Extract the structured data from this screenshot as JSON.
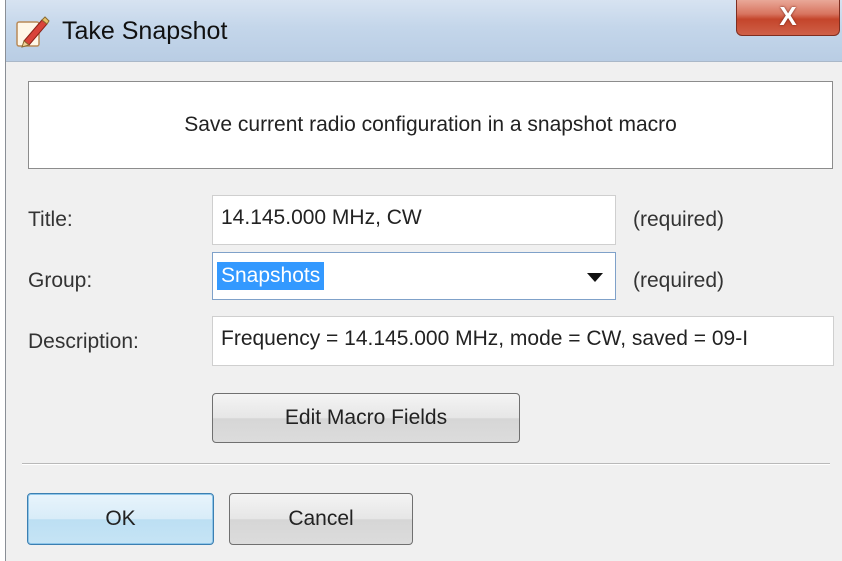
{
  "window": {
    "title": "Take Snapshot",
    "close_label": "X",
    "app_icon": "pencil-edit-icon"
  },
  "banner": {
    "text": "Save current radio configuration in a snapshot macro"
  },
  "form": {
    "title_label": "Title:",
    "title_value": "14.145.000 MHz, CW",
    "title_hint": "(required)",
    "group_label": "Group:",
    "group_value": "Snapshots",
    "group_hint": "(required)",
    "description_label": "Description:",
    "description_value": "Frequency = 14.145.000 MHz, mode = CW, saved = 09-I"
  },
  "buttons": {
    "edit_macro_fields": "Edit Macro Fields",
    "ok": "OK",
    "cancel": "Cancel"
  },
  "colors": {
    "selection": "#3399ff",
    "close_button": "#c4452b",
    "titlebar": "#c4d6ea"
  }
}
